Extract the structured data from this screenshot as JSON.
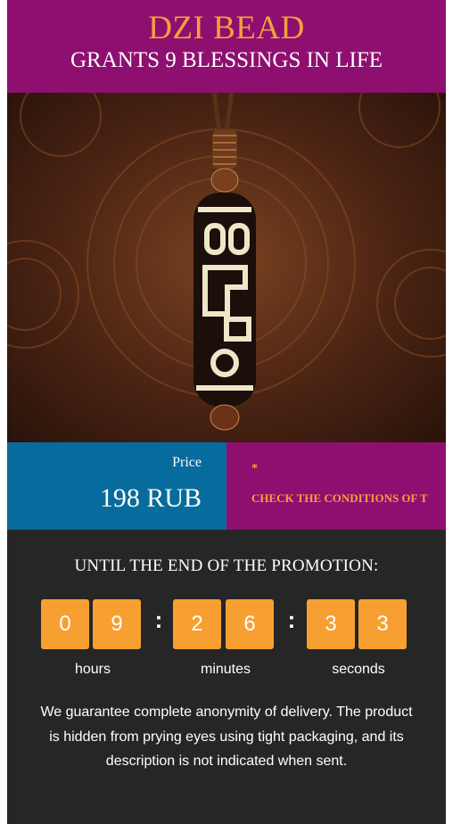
{
  "header": {
    "title": "DZI BEAD",
    "subtitle": "GRANTS 9 BLESSINGS IN LIFE"
  },
  "hero": {
    "image_alt": "dzi-bead-pendant-image"
  },
  "price": {
    "label": "Price",
    "value": "198 RUB"
  },
  "conditions": {
    "star": "*",
    "text": "CHECK THE CONDITIONS OF T"
  },
  "promotion": {
    "title": "UNTIL THE END OF THE PROMOTION:",
    "digits": [
      "0",
      "9",
      "2",
      "6",
      "3",
      "3"
    ],
    "colon": ":",
    "units": {
      "hours": "hours",
      "minutes": "minutes",
      "seconds": "seconds"
    }
  },
  "guarantee": {
    "text": "We guarantee complete anonymity of delivery. The product is hidden from prying eyes using tight packaging, and its description is not indicated when sent."
  },
  "colors": {
    "purple": "#8e0f70",
    "orange": "#f4a03c",
    "blue": "#086b9d",
    "dark": "#262626"
  }
}
